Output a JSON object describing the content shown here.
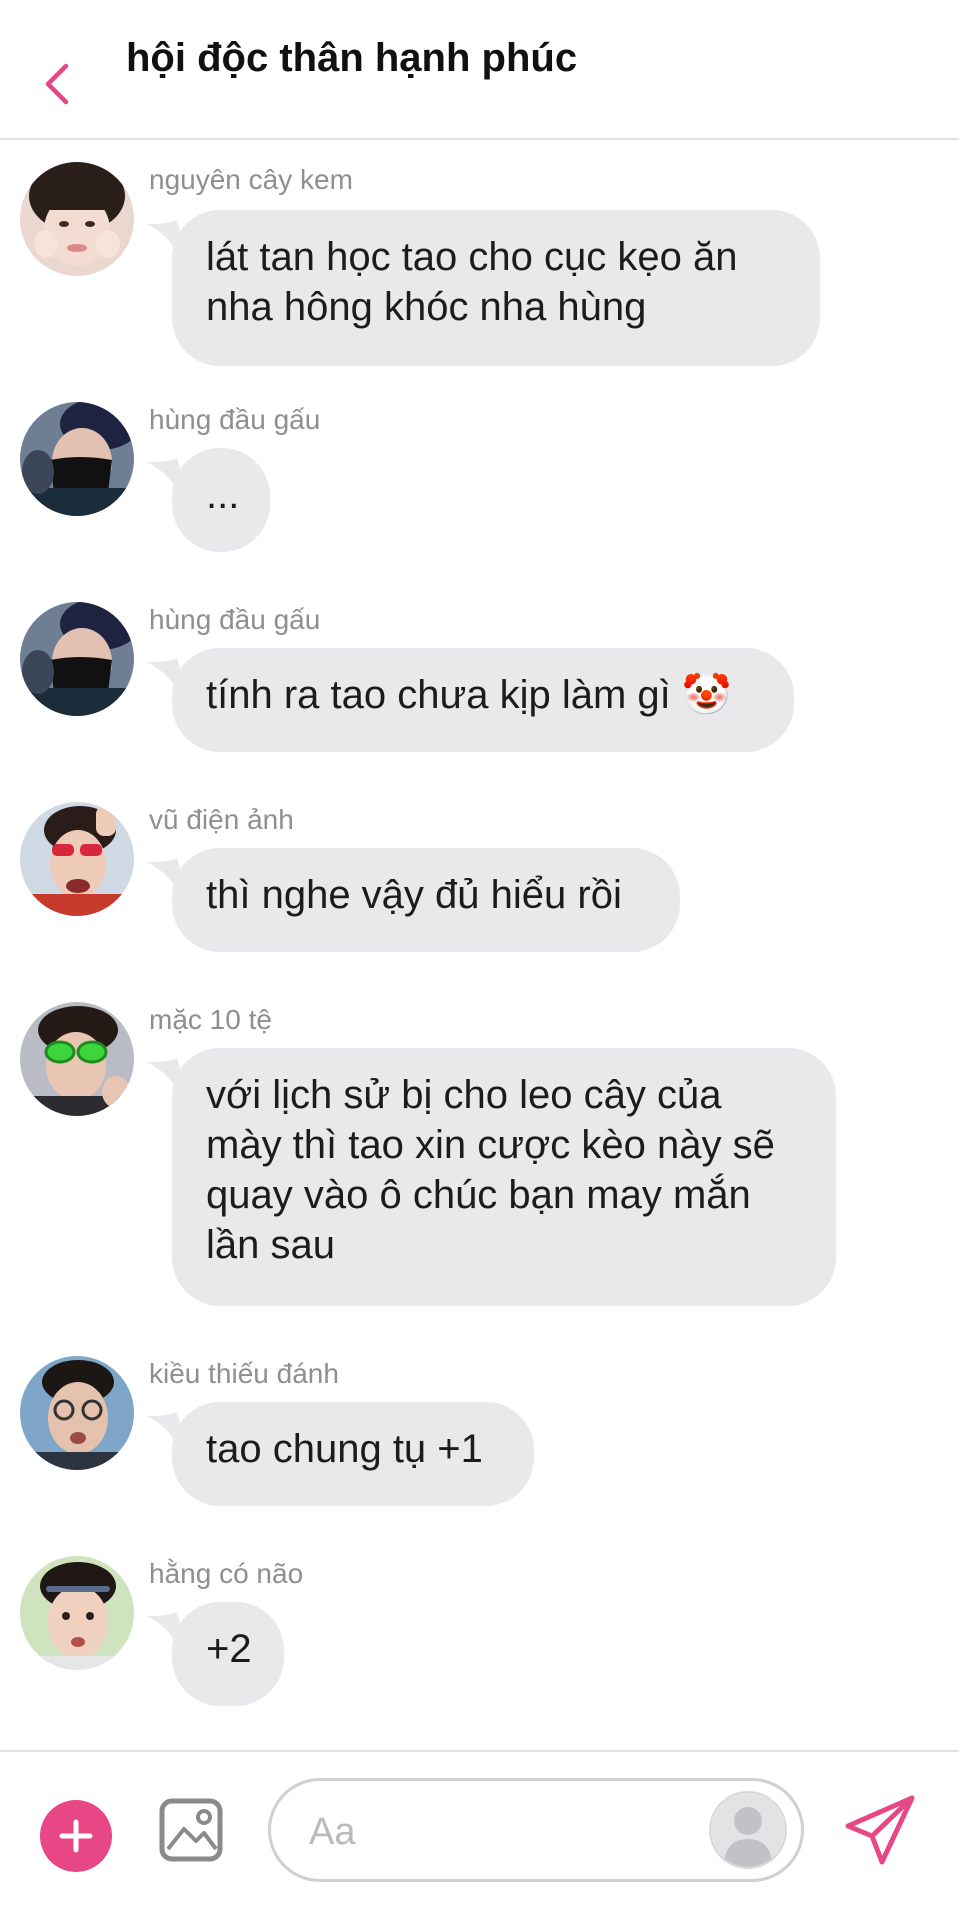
{
  "header": {
    "title": "hội độc thân hạnh phúc"
  },
  "messages": [
    {
      "sender": "nguyên cây kem",
      "lines": [
        "lát tan học tao cho cục kẹo ăn",
        "nha hông khóc nha hùng"
      ]
    },
    {
      "sender": "hùng đầu gấu",
      "lines": [
        "..."
      ]
    },
    {
      "sender": "hùng đầu gấu",
      "lines": [
        "tính ra tao chưa kịp làm gì 🤡"
      ]
    },
    {
      "sender": "vũ điện ảnh",
      "lines": [
        "thì nghe vậy đủ hiểu rồi"
      ]
    },
    {
      "sender": "mặc 10 tệ",
      "lines": [
        "với lịch sử bị cho leo cây của",
        "mày thì tao xin cược kèo này sẽ",
        "quay vào ô chúc bạn may mắn",
        "lần sau"
      ]
    },
    {
      "sender": "kiều thiếu đánh",
      "lines": [
        "tao chung tụ +1"
      ]
    },
    {
      "sender": "hằng có não",
      "lines": [
        "+2"
      ]
    }
  ],
  "composer": {
    "placeholder": "Aa"
  },
  "colors": {
    "accent": "#e84786",
    "bubble": "#e9e9eb",
    "sender": "#8e8e93"
  },
  "icons": [
    "chevron-left-icon",
    "plus-icon",
    "image-icon",
    "sticker-icon",
    "send-icon"
  ]
}
